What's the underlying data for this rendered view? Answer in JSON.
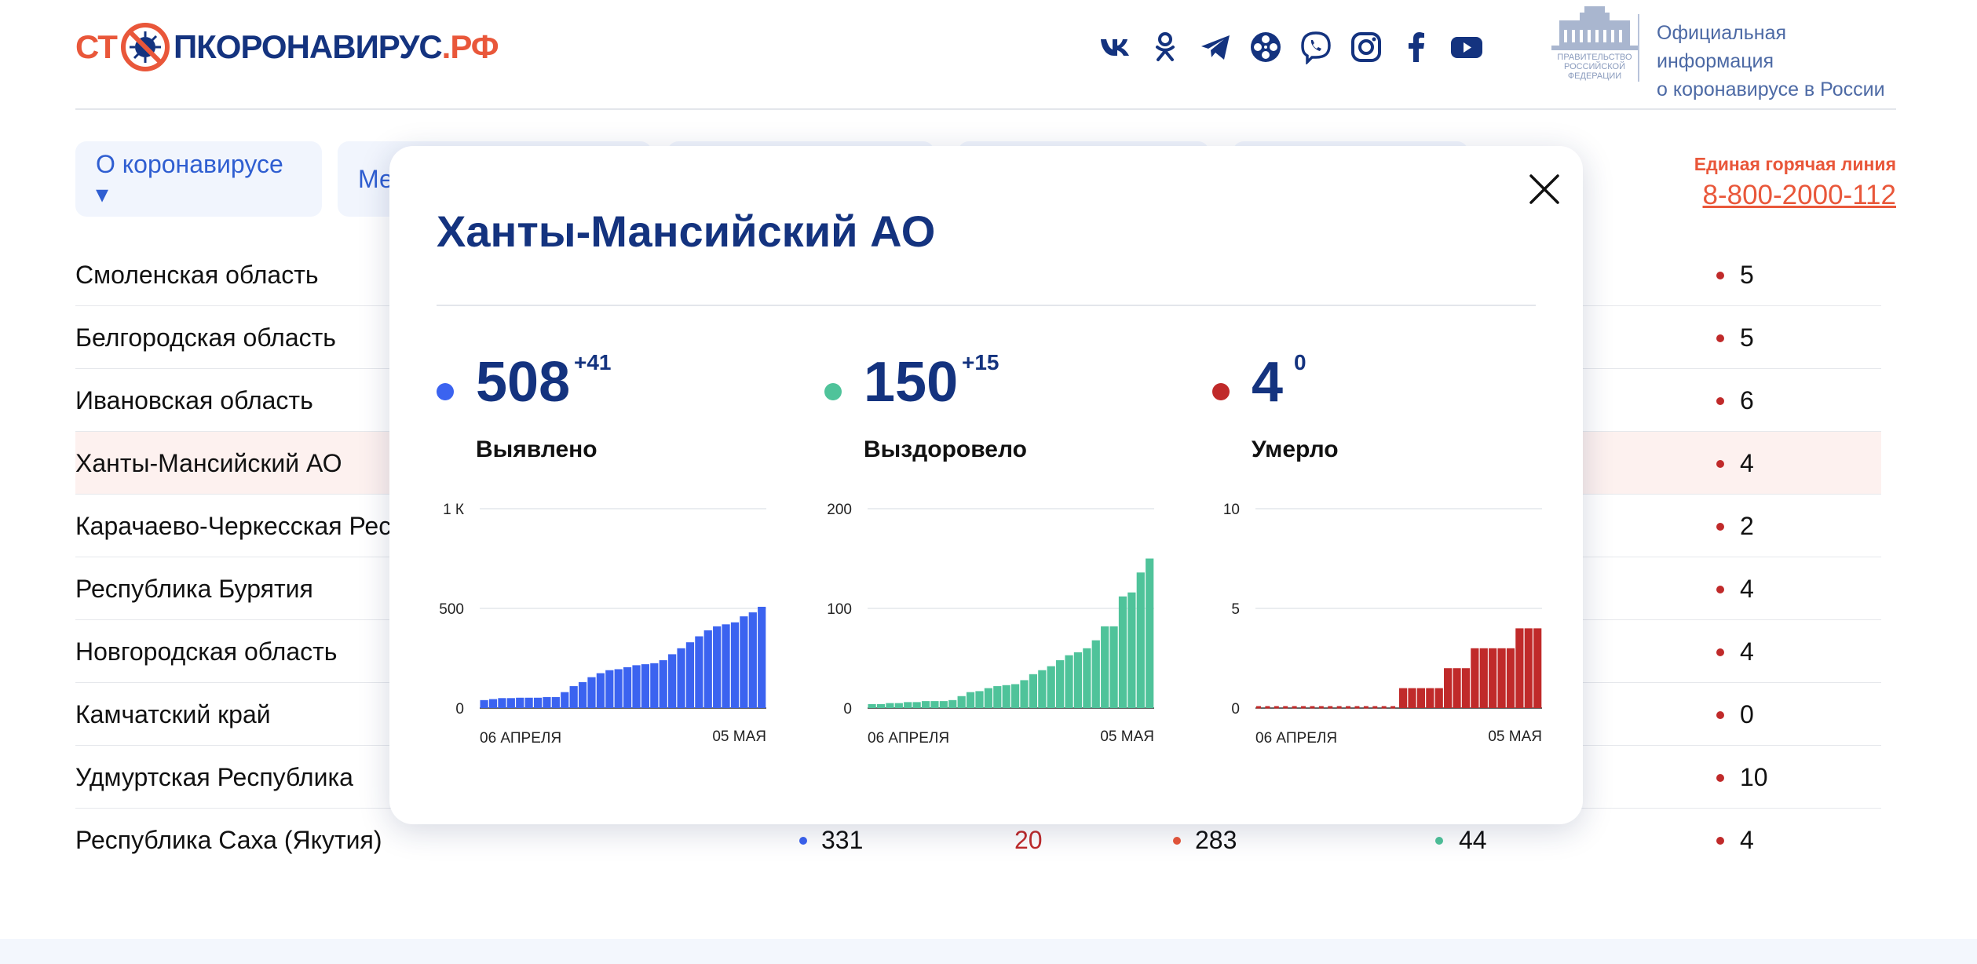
{
  "header": {
    "logo_part1": "СТ",
    "logo_part2": "ПКОРОНАВИРУС",
    "logo_part3": ".РФ",
    "socials": [
      {
        "icon": "vk-icon"
      },
      {
        "icon": "odnoklassniki-icon"
      },
      {
        "icon": "telegram-icon"
      },
      {
        "icon": "film-reel-icon"
      },
      {
        "icon": "viber-icon"
      },
      {
        "icon": "instagram-icon"
      },
      {
        "icon": "facebook-icon"
      },
      {
        "icon": "youtube-icon"
      }
    ],
    "gov_emblem_lines": [
      "ПРАВИТЕЛЬСТВО",
      "РОССИЙСКОЙ",
      "ФЕДЕРАЦИИ"
    ],
    "gov_text_line1": "Официальная информация",
    "gov_text_line2": "о коронавирусе в России"
  },
  "nav": {
    "item1": "О коронавирусе ▾",
    "item2": "Ме"
  },
  "hotline": {
    "caption": "Единая горячая линия",
    "number": "8-800-2000-112"
  },
  "table": {
    "rows": [
      {
        "region": "Смоленская область",
        "deaths": "5"
      },
      {
        "region": "Белгородская область",
        "deaths": "5"
      },
      {
        "region": "Ивановская область",
        "deaths": "6"
      },
      {
        "region": "Ханты-Мансийский АО",
        "deaths": "4"
      },
      {
        "region": "Карачаево-Черкесская Рес",
        "deaths": "2"
      },
      {
        "region": "Республика Бурятия",
        "deaths": "4"
      },
      {
        "region": "Новгородская область",
        "deaths": "4"
      },
      {
        "region": "Камчатский край",
        "deaths": "0"
      },
      {
        "region": "Удмуртская Республика",
        "deaths": "10"
      },
      {
        "region": "Республика Саха (Якутия)",
        "cases": "331",
        "cases_delta": "20",
        "active": "283",
        "recovered": "44",
        "deaths": "4"
      }
    ]
  },
  "modal": {
    "title": "Ханты-Мансийский АО",
    "stats": [
      {
        "value": "508",
        "delta": "+41",
        "label": "Выявлено",
        "color": "#3b63f0"
      },
      {
        "value": "150",
        "delta": "+15",
        "label": "Выздоровело",
        "color": "#4fc39a"
      },
      {
        "value": "4",
        "delta": "0",
        "label": "Умерло",
        "color": "#c02a2a"
      }
    ]
  },
  "colors": {
    "brand_blue": "#14337f",
    "brand_red": "#e9573a",
    "cases": "#3b63f0",
    "recovered": "#4fc39a",
    "deaths": "#c02a2a"
  },
  "chart_data": [
    {
      "type": "bar",
      "x_labels": [
        "06 АПРЕЛЯ",
        "05 МАЯ"
      ],
      "yticks": [
        {
          "v": 0,
          "label": "0"
        },
        {
          "v": 500,
          "label": "500"
        },
        {
          "v": 1000,
          "label": "1 К"
        }
      ],
      "ylim": [
        0,
        1000
      ],
      "grid": true,
      "color": "#3b63f0",
      "values": [
        40,
        45,
        50,
        50,
        52,
        52,
        52,
        55,
        55,
        80,
        110,
        130,
        155,
        175,
        190,
        195,
        205,
        215,
        220,
        225,
        240,
        270,
        300,
        330,
        360,
        390,
        410,
        420,
        430,
        460,
        480,
        508
      ]
    },
    {
      "type": "bar",
      "x_labels": [
        "06 АПРЕЛЯ",
        "05 МАЯ"
      ],
      "yticks": [
        {
          "v": 0,
          "label": "0"
        },
        {
          "v": 100,
          "label": "100"
        },
        {
          "v": 200,
          "label": "200"
        }
      ],
      "ylim": [
        0,
        200
      ],
      "grid": true,
      "color": "#4fc39a",
      "values": [
        4,
        4,
        5,
        5,
        6,
        6,
        7,
        7,
        7,
        8,
        12,
        16,
        17,
        20,
        22,
        23,
        24,
        28,
        34,
        38,
        42,
        48,
        53,
        56,
        60,
        68,
        82,
        82,
        112,
        116,
        136,
        150
      ]
    },
    {
      "type": "bar",
      "x_labels": [
        "06 АПРЕЛЯ",
        "05 МАЯ"
      ],
      "yticks": [
        {
          "v": 0,
          "label": "0"
        },
        {
          "v": 5,
          "label": "5"
        },
        {
          "v": 10,
          "label": "10"
        }
      ],
      "ylim": [
        0,
        10
      ],
      "grid": true,
      "color": "#c02a2a",
      "values": [
        0,
        0,
        0,
        0,
        0,
        0,
        0,
        0,
        0,
        0,
        0,
        0,
        0,
        0,
        0,
        0,
        1,
        1,
        1,
        1,
        1,
        2,
        2,
        2,
        3,
        3,
        3,
        3,
        3,
        4,
        4,
        4
      ]
    }
  ]
}
